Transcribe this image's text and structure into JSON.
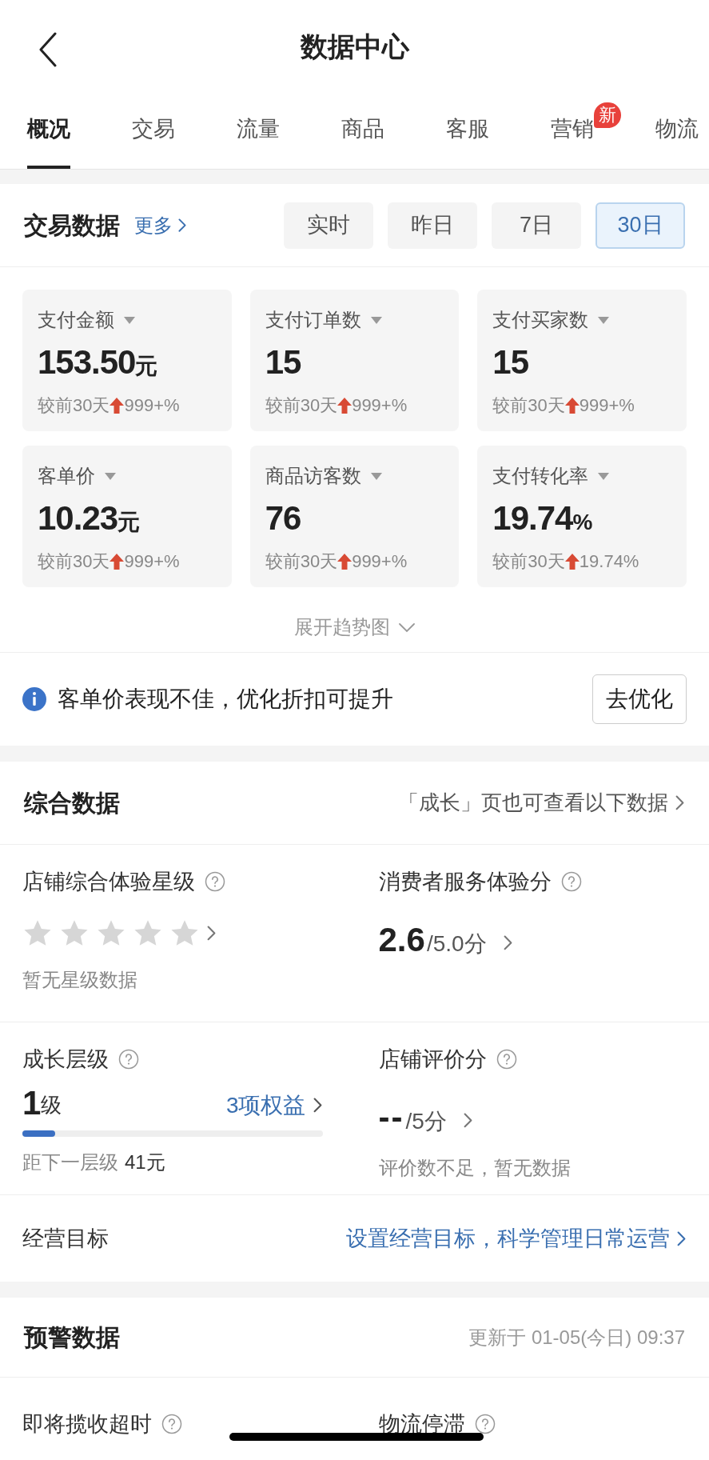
{
  "header": {
    "title": "数据中心"
  },
  "tabs": [
    {
      "label": "概况",
      "selected": true
    },
    {
      "label": "交易",
      "selected": false
    },
    {
      "label": "流量",
      "selected": false
    },
    {
      "label": "商品",
      "selected": false
    },
    {
      "label": "客服",
      "selected": false
    },
    {
      "label": "营销",
      "selected": false,
      "badge": "新"
    },
    {
      "label": "物流",
      "selected": false
    }
  ],
  "trade": {
    "title": "交易数据",
    "more": "更多",
    "periods": [
      {
        "label": "实时",
        "selected": false
      },
      {
        "label": "昨日",
        "selected": false
      },
      {
        "label": "7日",
        "selected": false
      },
      {
        "label": "30日",
        "selected": true
      }
    ],
    "metrics": [
      {
        "label": "支付金额",
        "value": "153.50",
        "unit": "元",
        "compare": "较前30天",
        "kind": "up",
        "change": "999+%"
      },
      {
        "label": "支付订单数",
        "value": "15",
        "compare": "较前30天",
        "kind": "up",
        "change": "999+%"
      },
      {
        "label": "支付买家数",
        "value": "15",
        "compare": "较前30天",
        "kind": "up",
        "change": "999+%"
      },
      {
        "label": "客单价",
        "value": "10.23",
        "unit": "元",
        "compare": "较前30天",
        "kind": "up",
        "change": "999+%"
      },
      {
        "label": "商品访客数",
        "value": "76",
        "compare": "较前30天",
        "kind": "up",
        "change": "999+%"
      },
      {
        "label": "支付转化率",
        "value": "19.74",
        "unit": "%",
        "compare": "较前30天",
        "kind": "up",
        "change": "19.74%"
      }
    ],
    "expand": "展开趋势图"
  },
  "tip": {
    "text": "客单价表现不佳，优化折扣可提升",
    "button": "去优化"
  },
  "overall": {
    "title": "综合数据",
    "link": "「成长」页也可查看以下数据",
    "star_rating": {
      "label": "店铺综合体验星级",
      "stars": 0,
      "note": "暂无星级数据"
    },
    "service_score": {
      "label": "消费者服务体验分",
      "value": "2.6",
      "max": "/5.0分"
    },
    "growth": {
      "label": "成长层级",
      "value": "1",
      "unit": "级",
      "benefits": "3项权益",
      "level": 0.11,
      "note": "距下一层级",
      "note_value": "41元"
    },
    "review_score": {
      "label": "店铺评价分",
      "value": "--",
      "max": "/5分",
      "note": "评价数不足，暂无数据"
    },
    "goal": {
      "label": "经营目标",
      "link": "设置经营目标，科学管理日常运营"
    }
  },
  "warning": {
    "title": "预警数据",
    "updated": "更新于 01-05(今日) 09:37",
    "items": [
      {
        "label": "即将揽收超时"
      },
      {
        "label": "物流停滞"
      }
    ]
  }
}
